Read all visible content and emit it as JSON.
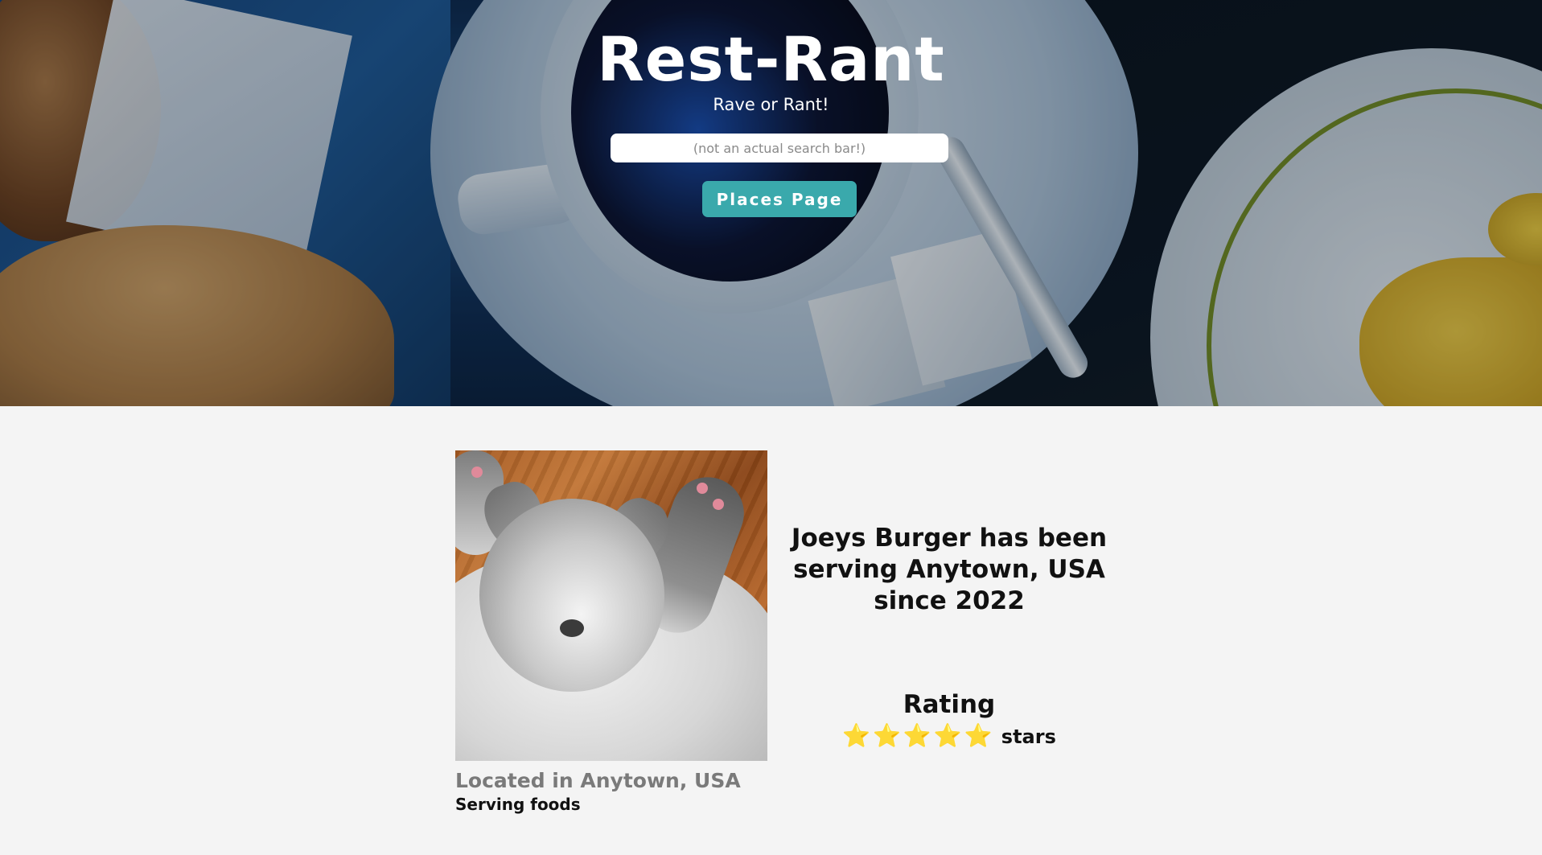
{
  "hero": {
    "title": "Rest-Rant",
    "tagline": "Rave or Rant!",
    "search_placeholder": "(not an actual search bar!)",
    "places_button_label": "Places Page"
  },
  "place": {
    "description": "Joeys Burger has been serving Anytown, USA since 2022",
    "location": "Located in Anytown, USA",
    "cuisines": "Serving foods",
    "rating": {
      "heading": "Rating",
      "stars": "⭐⭐⭐⭐⭐",
      "star_count": 5,
      "suffix": "stars"
    }
  },
  "colors": {
    "button": "#3aa9ac",
    "page_background": "#f4f4f4",
    "star": "#f5c33b"
  },
  "icons": {
    "rating": "star-icon"
  }
}
